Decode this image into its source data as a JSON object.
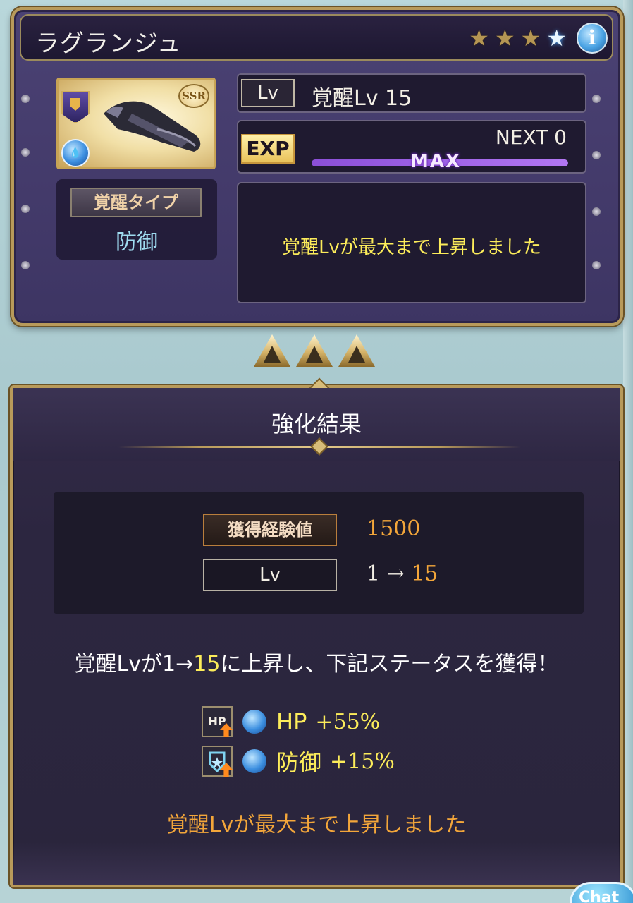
{
  "weapon": {
    "name": "ラグランジュ",
    "rarity": "SSR",
    "stars_filled": 3,
    "stars_total": 4,
    "info_label": "i",
    "element": "water"
  },
  "level": {
    "tag": "Lv",
    "value": "覚醒Lv 15"
  },
  "exp": {
    "tag": "EXP",
    "next": "NEXT 0",
    "max_label": "MAX",
    "progress": 1.0
  },
  "awaken": {
    "label": "覚醒タイプ",
    "value": "防御"
  },
  "message_box": {
    "text": "覚醒Lvが最大まで上昇しました"
  },
  "result": {
    "title": "強化結果",
    "gain_label": "獲得経験値",
    "gain_value": "1500",
    "lv_label": "Lv",
    "lv_from": "1",
    "lv_arrow": "→",
    "lv_to": "15",
    "summary_prefix": "覚醒Lvが",
    "summary_from": "1",
    "summary_arrow": "→",
    "summary_to": "15",
    "summary_suffix": "に上昇し、下記ステータスを獲得！",
    "bonuses": [
      {
        "icon": "hp-up-icon",
        "icon_text": "HP",
        "label": "HP",
        "value": "+55%"
      },
      {
        "icon": "defense-up-icon",
        "icon_text": "",
        "label": "防御",
        "value": "+15%"
      }
    ],
    "footer": "覚醒Lvが最大まで上昇しました"
  },
  "chat": {
    "label": "Chat"
  },
  "colors": {
    "accent_gold": "#b89a5a",
    "panel_purple": "#433a6a",
    "highlight_yellow": "#fcec5a",
    "highlight_orange": "#f3a63a",
    "exp_bar": "#8b4fd8"
  }
}
